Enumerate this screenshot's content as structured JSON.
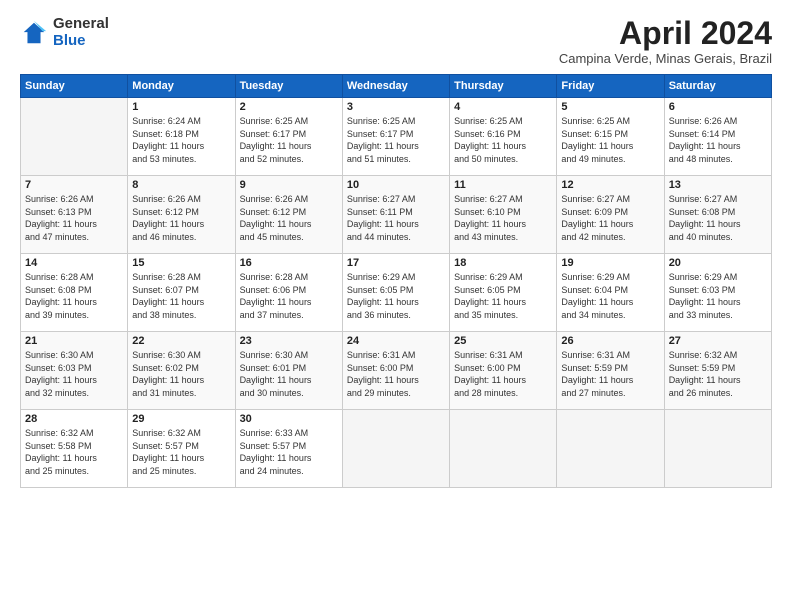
{
  "logo": {
    "general": "General",
    "blue": "Blue"
  },
  "title": "April 2024",
  "subtitle": "Campina Verde, Minas Gerais, Brazil",
  "days_header": [
    "Sunday",
    "Monday",
    "Tuesday",
    "Wednesday",
    "Thursday",
    "Friday",
    "Saturday"
  ],
  "weeks": [
    [
      {
        "day": "",
        "data": ""
      },
      {
        "day": "1",
        "data": "Sunrise: 6:24 AM\nSunset: 6:18 PM\nDaylight: 11 hours\nand 53 minutes."
      },
      {
        "day": "2",
        "data": "Sunrise: 6:25 AM\nSunset: 6:17 PM\nDaylight: 11 hours\nand 52 minutes."
      },
      {
        "day": "3",
        "data": "Sunrise: 6:25 AM\nSunset: 6:17 PM\nDaylight: 11 hours\nand 51 minutes."
      },
      {
        "day": "4",
        "data": "Sunrise: 6:25 AM\nSunset: 6:16 PM\nDaylight: 11 hours\nand 50 minutes."
      },
      {
        "day": "5",
        "data": "Sunrise: 6:25 AM\nSunset: 6:15 PM\nDaylight: 11 hours\nand 49 minutes."
      },
      {
        "day": "6",
        "data": "Sunrise: 6:26 AM\nSunset: 6:14 PM\nDaylight: 11 hours\nand 48 minutes."
      }
    ],
    [
      {
        "day": "7",
        "data": "Sunrise: 6:26 AM\nSunset: 6:13 PM\nDaylight: 11 hours\nand 47 minutes."
      },
      {
        "day": "8",
        "data": "Sunrise: 6:26 AM\nSunset: 6:12 PM\nDaylight: 11 hours\nand 46 minutes."
      },
      {
        "day": "9",
        "data": "Sunrise: 6:26 AM\nSunset: 6:12 PM\nDaylight: 11 hours\nand 45 minutes."
      },
      {
        "day": "10",
        "data": "Sunrise: 6:27 AM\nSunset: 6:11 PM\nDaylight: 11 hours\nand 44 minutes."
      },
      {
        "day": "11",
        "data": "Sunrise: 6:27 AM\nSunset: 6:10 PM\nDaylight: 11 hours\nand 43 minutes."
      },
      {
        "day": "12",
        "data": "Sunrise: 6:27 AM\nSunset: 6:09 PM\nDaylight: 11 hours\nand 42 minutes."
      },
      {
        "day": "13",
        "data": "Sunrise: 6:27 AM\nSunset: 6:08 PM\nDaylight: 11 hours\nand 40 minutes."
      }
    ],
    [
      {
        "day": "14",
        "data": "Sunrise: 6:28 AM\nSunset: 6:08 PM\nDaylight: 11 hours\nand 39 minutes."
      },
      {
        "day": "15",
        "data": "Sunrise: 6:28 AM\nSunset: 6:07 PM\nDaylight: 11 hours\nand 38 minutes."
      },
      {
        "day": "16",
        "data": "Sunrise: 6:28 AM\nSunset: 6:06 PM\nDaylight: 11 hours\nand 37 minutes."
      },
      {
        "day": "17",
        "data": "Sunrise: 6:29 AM\nSunset: 6:05 PM\nDaylight: 11 hours\nand 36 minutes."
      },
      {
        "day": "18",
        "data": "Sunrise: 6:29 AM\nSunset: 6:05 PM\nDaylight: 11 hours\nand 35 minutes."
      },
      {
        "day": "19",
        "data": "Sunrise: 6:29 AM\nSunset: 6:04 PM\nDaylight: 11 hours\nand 34 minutes."
      },
      {
        "day": "20",
        "data": "Sunrise: 6:29 AM\nSunset: 6:03 PM\nDaylight: 11 hours\nand 33 minutes."
      }
    ],
    [
      {
        "day": "21",
        "data": "Sunrise: 6:30 AM\nSunset: 6:03 PM\nDaylight: 11 hours\nand 32 minutes."
      },
      {
        "day": "22",
        "data": "Sunrise: 6:30 AM\nSunset: 6:02 PM\nDaylight: 11 hours\nand 31 minutes."
      },
      {
        "day": "23",
        "data": "Sunrise: 6:30 AM\nSunset: 6:01 PM\nDaylight: 11 hours\nand 30 minutes."
      },
      {
        "day": "24",
        "data": "Sunrise: 6:31 AM\nSunset: 6:00 PM\nDaylight: 11 hours\nand 29 minutes."
      },
      {
        "day": "25",
        "data": "Sunrise: 6:31 AM\nSunset: 6:00 PM\nDaylight: 11 hours\nand 28 minutes."
      },
      {
        "day": "26",
        "data": "Sunrise: 6:31 AM\nSunset: 5:59 PM\nDaylight: 11 hours\nand 27 minutes."
      },
      {
        "day": "27",
        "data": "Sunrise: 6:32 AM\nSunset: 5:59 PM\nDaylight: 11 hours\nand 26 minutes."
      }
    ],
    [
      {
        "day": "28",
        "data": "Sunrise: 6:32 AM\nSunset: 5:58 PM\nDaylight: 11 hours\nand 25 minutes."
      },
      {
        "day": "29",
        "data": "Sunrise: 6:32 AM\nSunset: 5:57 PM\nDaylight: 11 hours\nand 25 minutes."
      },
      {
        "day": "30",
        "data": "Sunrise: 6:33 AM\nSunset: 5:57 PM\nDaylight: 11 hours\nand 24 minutes."
      },
      {
        "day": "",
        "data": ""
      },
      {
        "day": "",
        "data": ""
      },
      {
        "day": "",
        "data": ""
      },
      {
        "day": "",
        "data": ""
      }
    ]
  ]
}
